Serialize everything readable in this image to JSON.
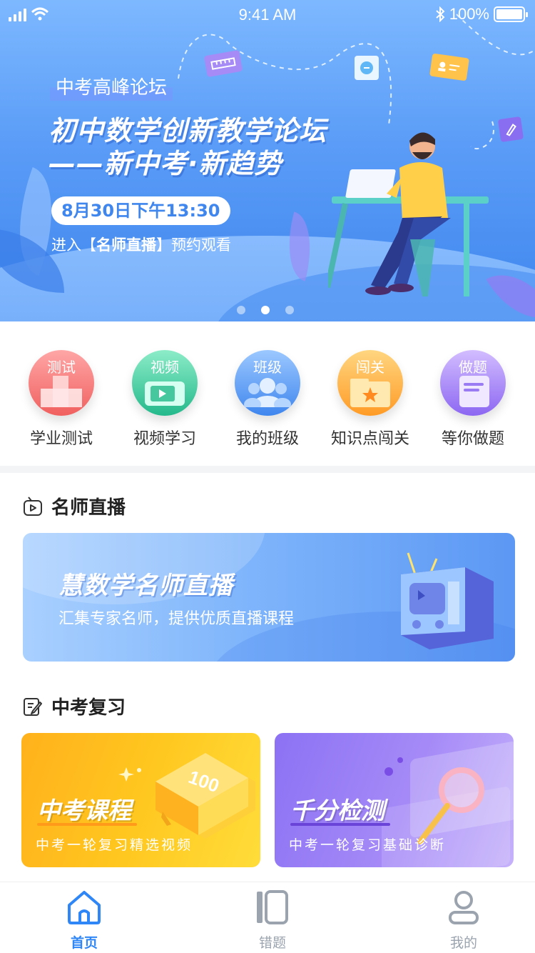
{
  "status_bar": {
    "time": "9:41 AM",
    "battery": "100%"
  },
  "banner": {
    "tag": "中考高峰论坛",
    "headline_line1": "初中数学创新教学论坛",
    "headline_line2": "——新中考·新趋势",
    "date": "8月30日下午13:30",
    "enter_prefix": "进入【",
    "enter_highlight": "名师直播",
    "enter_suffix": "】预约观看",
    "page_count": 3,
    "active_page": 2
  },
  "quick_entries": [
    {
      "caption": "测试",
      "label": "学业测试",
      "icon": "test-icon",
      "color_top": "#ff9a9a",
      "color_bottom": "#f0605f"
    },
    {
      "caption": "视频",
      "label": "视频学习",
      "icon": "video-tv-icon",
      "color_top": "#7ee6c0",
      "color_bottom": "#24b98b"
    },
    {
      "caption": "班级",
      "label": "我的班级",
      "icon": "class-group-icon",
      "color_top": "#8cc0ff",
      "color_bottom": "#3f86ee"
    },
    {
      "caption": "闯关",
      "label": "知识点闯关",
      "icon": "challenge-star-icon",
      "color_top": "#ffd27a",
      "color_bottom": "#ff9b26"
    },
    {
      "caption": "做题",
      "label": "等你做题",
      "icon": "exercise-paper-icon",
      "color_top": "#cdb6ff",
      "color_bottom": "#8c67f2"
    }
  ],
  "live_section": {
    "title": "名师直播",
    "card_title": "慧数学名师直播",
    "card_subtitle": "汇集专家名师，提供优质直播课程"
  },
  "review_section": {
    "title": "中考复习",
    "cards": [
      {
        "title": "中考课程",
        "subtitle": "中考一轮复习精选视频",
        "badge": "100"
      },
      {
        "title": "千分检测",
        "subtitle": "中考一轮复习基础诊断"
      }
    ]
  },
  "tabbar": {
    "items": [
      {
        "label": "首页",
        "icon": "home-icon",
        "active": true
      },
      {
        "label": "错题",
        "icon": "wrong-book-icon",
        "active": false
      },
      {
        "label": "我的",
        "icon": "profile-icon",
        "active": false
      }
    ],
    "active_color": "#2f86f6",
    "inactive_color": "#9aa3ae"
  }
}
